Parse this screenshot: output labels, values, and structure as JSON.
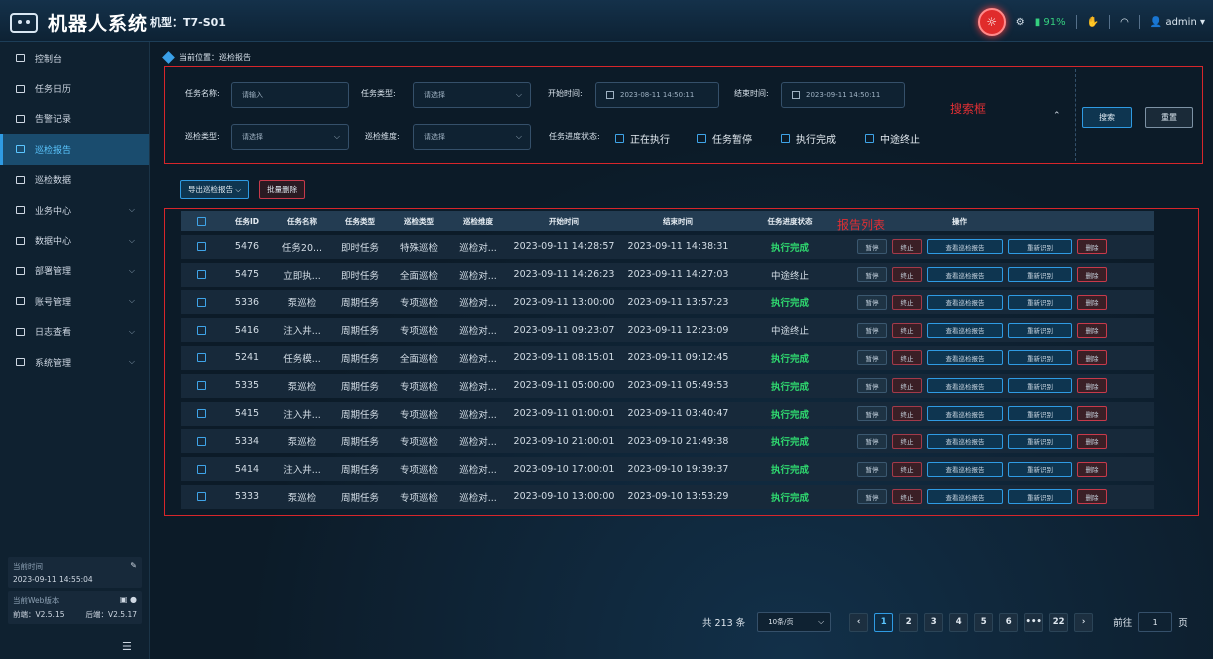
{
  "header": {
    "title": "机器人系统",
    "model": "机型：T7-S01",
    "battery": "91%",
    "user": "admin"
  },
  "sidebar": {
    "items": [
      {
        "label": "控制台",
        "active": false,
        "expand": false
      },
      {
        "label": "任务日历",
        "active": false,
        "expand": false
      },
      {
        "label": "告警记录",
        "active": false,
        "expand": false
      },
      {
        "label": "巡检报告",
        "active": true,
        "expand": false
      },
      {
        "label": "巡检数据",
        "active": false,
        "expand": false
      },
      {
        "label": "业务中心",
        "active": false,
        "expand": true
      },
      {
        "label": "数据中心",
        "active": false,
        "expand": true
      },
      {
        "label": "部署管理",
        "active": false,
        "expand": true
      },
      {
        "label": "账号管理",
        "active": false,
        "expand": true
      },
      {
        "label": "日志查看",
        "active": false,
        "expand": true
      },
      {
        "label": "系统管理",
        "active": false,
        "expand": true
      }
    ],
    "footer": {
      "time_label": "当前时间",
      "time_value": "2023-09-11 14:55:04",
      "version_label": "当前Web版本",
      "front": "前端：V2.5.15",
      "back": "后端：V2.5.17"
    }
  },
  "breadcrumb": "当前位置：巡检报告",
  "search": {
    "task_name_label": "任务名称:",
    "task_name_placeholder": "请输入",
    "task_type_label": "任务类型:",
    "task_type_value": "请选择",
    "start_label": "开始时间:",
    "start_value": "2023-08-11 14:50:11",
    "end_label": "结束时间:",
    "end_value": "2023-09-11 14:50:11",
    "inspect_type_label": "巡检类型:",
    "inspect_type_value": "请选择",
    "inspect_dim_label": "巡检维度:",
    "inspect_dim_value": "请选择",
    "status_label": "任务进度状态:",
    "statuses": [
      "正在执行",
      "任务暂停",
      "执行完成",
      "中途终止"
    ],
    "search_btn": "搜索",
    "reset_btn": "重置",
    "annotation": "搜索框"
  },
  "toolbar": {
    "export": "导出巡检报告",
    "batch_delete": "批量删除"
  },
  "table": {
    "annotation": "报告列表",
    "headers": [
      "任务ID",
      "任务名称",
      "任务类型",
      "巡检类型",
      "巡检维度",
      "开始时间",
      "结束时间",
      "任务进度状态",
      "操作"
    ],
    "actions": {
      "pause": "暂停",
      "stop": "终止",
      "view": "查看巡检报告",
      "recog": "重新识别",
      "del": "删除"
    },
    "rows": [
      [
        "5476",
        "任务20...",
        "即时任务",
        "特殊巡检",
        "巡检对...",
        "2023-09-11 14:28:57",
        "2023-09-11 14:38:31",
        "执行完成"
      ],
      [
        "5475",
        "立即执...",
        "即时任务",
        "全面巡检",
        "巡检对...",
        "2023-09-11 14:26:23",
        "2023-09-11 14:27:03",
        "中途终止"
      ],
      [
        "5336",
        "泵巡检",
        "周期任务",
        "专项巡检",
        "巡检对...",
        "2023-09-11 13:00:00",
        "2023-09-11 13:57:23",
        "执行完成"
      ],
      [
        "5416",
        "注入井...",
        "周期任务",
        "专项巡检",
        "巡检对...",
        "2023-09-11 09:23:07",
        "2023-09-11 12:23:09",
        "中途终止"
      ],
      [
        "5241",
        "任务模...",
        "周期任务",
        "全面巡检",
        "巡检对...",
        "2023-09-11 08:15:01",
        "2023-09-11 09:12:45",
        "执行完成"
      ],
      [
        "5335",
        "泵巡检",
        "周期任务",
        "专项巡检",
        "巡检对...",
        "2023-09-11 05:00:00",
        "2023-09-11 05:49:53",
        "执行完成"
      ],
      [
        "5415",
        "注入井...",
        "周期任务",
        "专项巡检",
        "巡检对...",
        "2023-09-11 01:00:01",
        "2023-09-11 03:40:47",
        "执行完成"
      ],
      [
        "5334",
        "泵巡检",
        "周期任务",
        "专项巡检",
        "巡检对...",
        "2023-09-10 21:00:01",
        "2023-09-10 21:49:38",
        "执行完成"
      ],
      [
        "5414",
        "注入井...",
        "周期任务",
        "专项巡检",
        "巡检对...",
        "2023-09-10 17:00:01",
        "2023-09-10 19:39:37",
        "执行完成"
      ],
      [
        "5333",
        "泵巡检",
        "周期任务",
        "专项巡检",
        "巡检对...",
        "2023-09-10 13:00:00",
        "2023-09-10 13:53:29",
        "执行完成"
      ]
    ]
  },
  "pager": {
    "total": "共 213 条",
    "size": "10条/页",
    "pages": [
      "1",
      "2",
      "3",
      "4",
      "5",
      "6",
      "•••",
      "22"
    ],
    "current": "1",
    "goto_label": "前往",
    "goto_value": "1",
    "goto_unit": "页"
  }
}
